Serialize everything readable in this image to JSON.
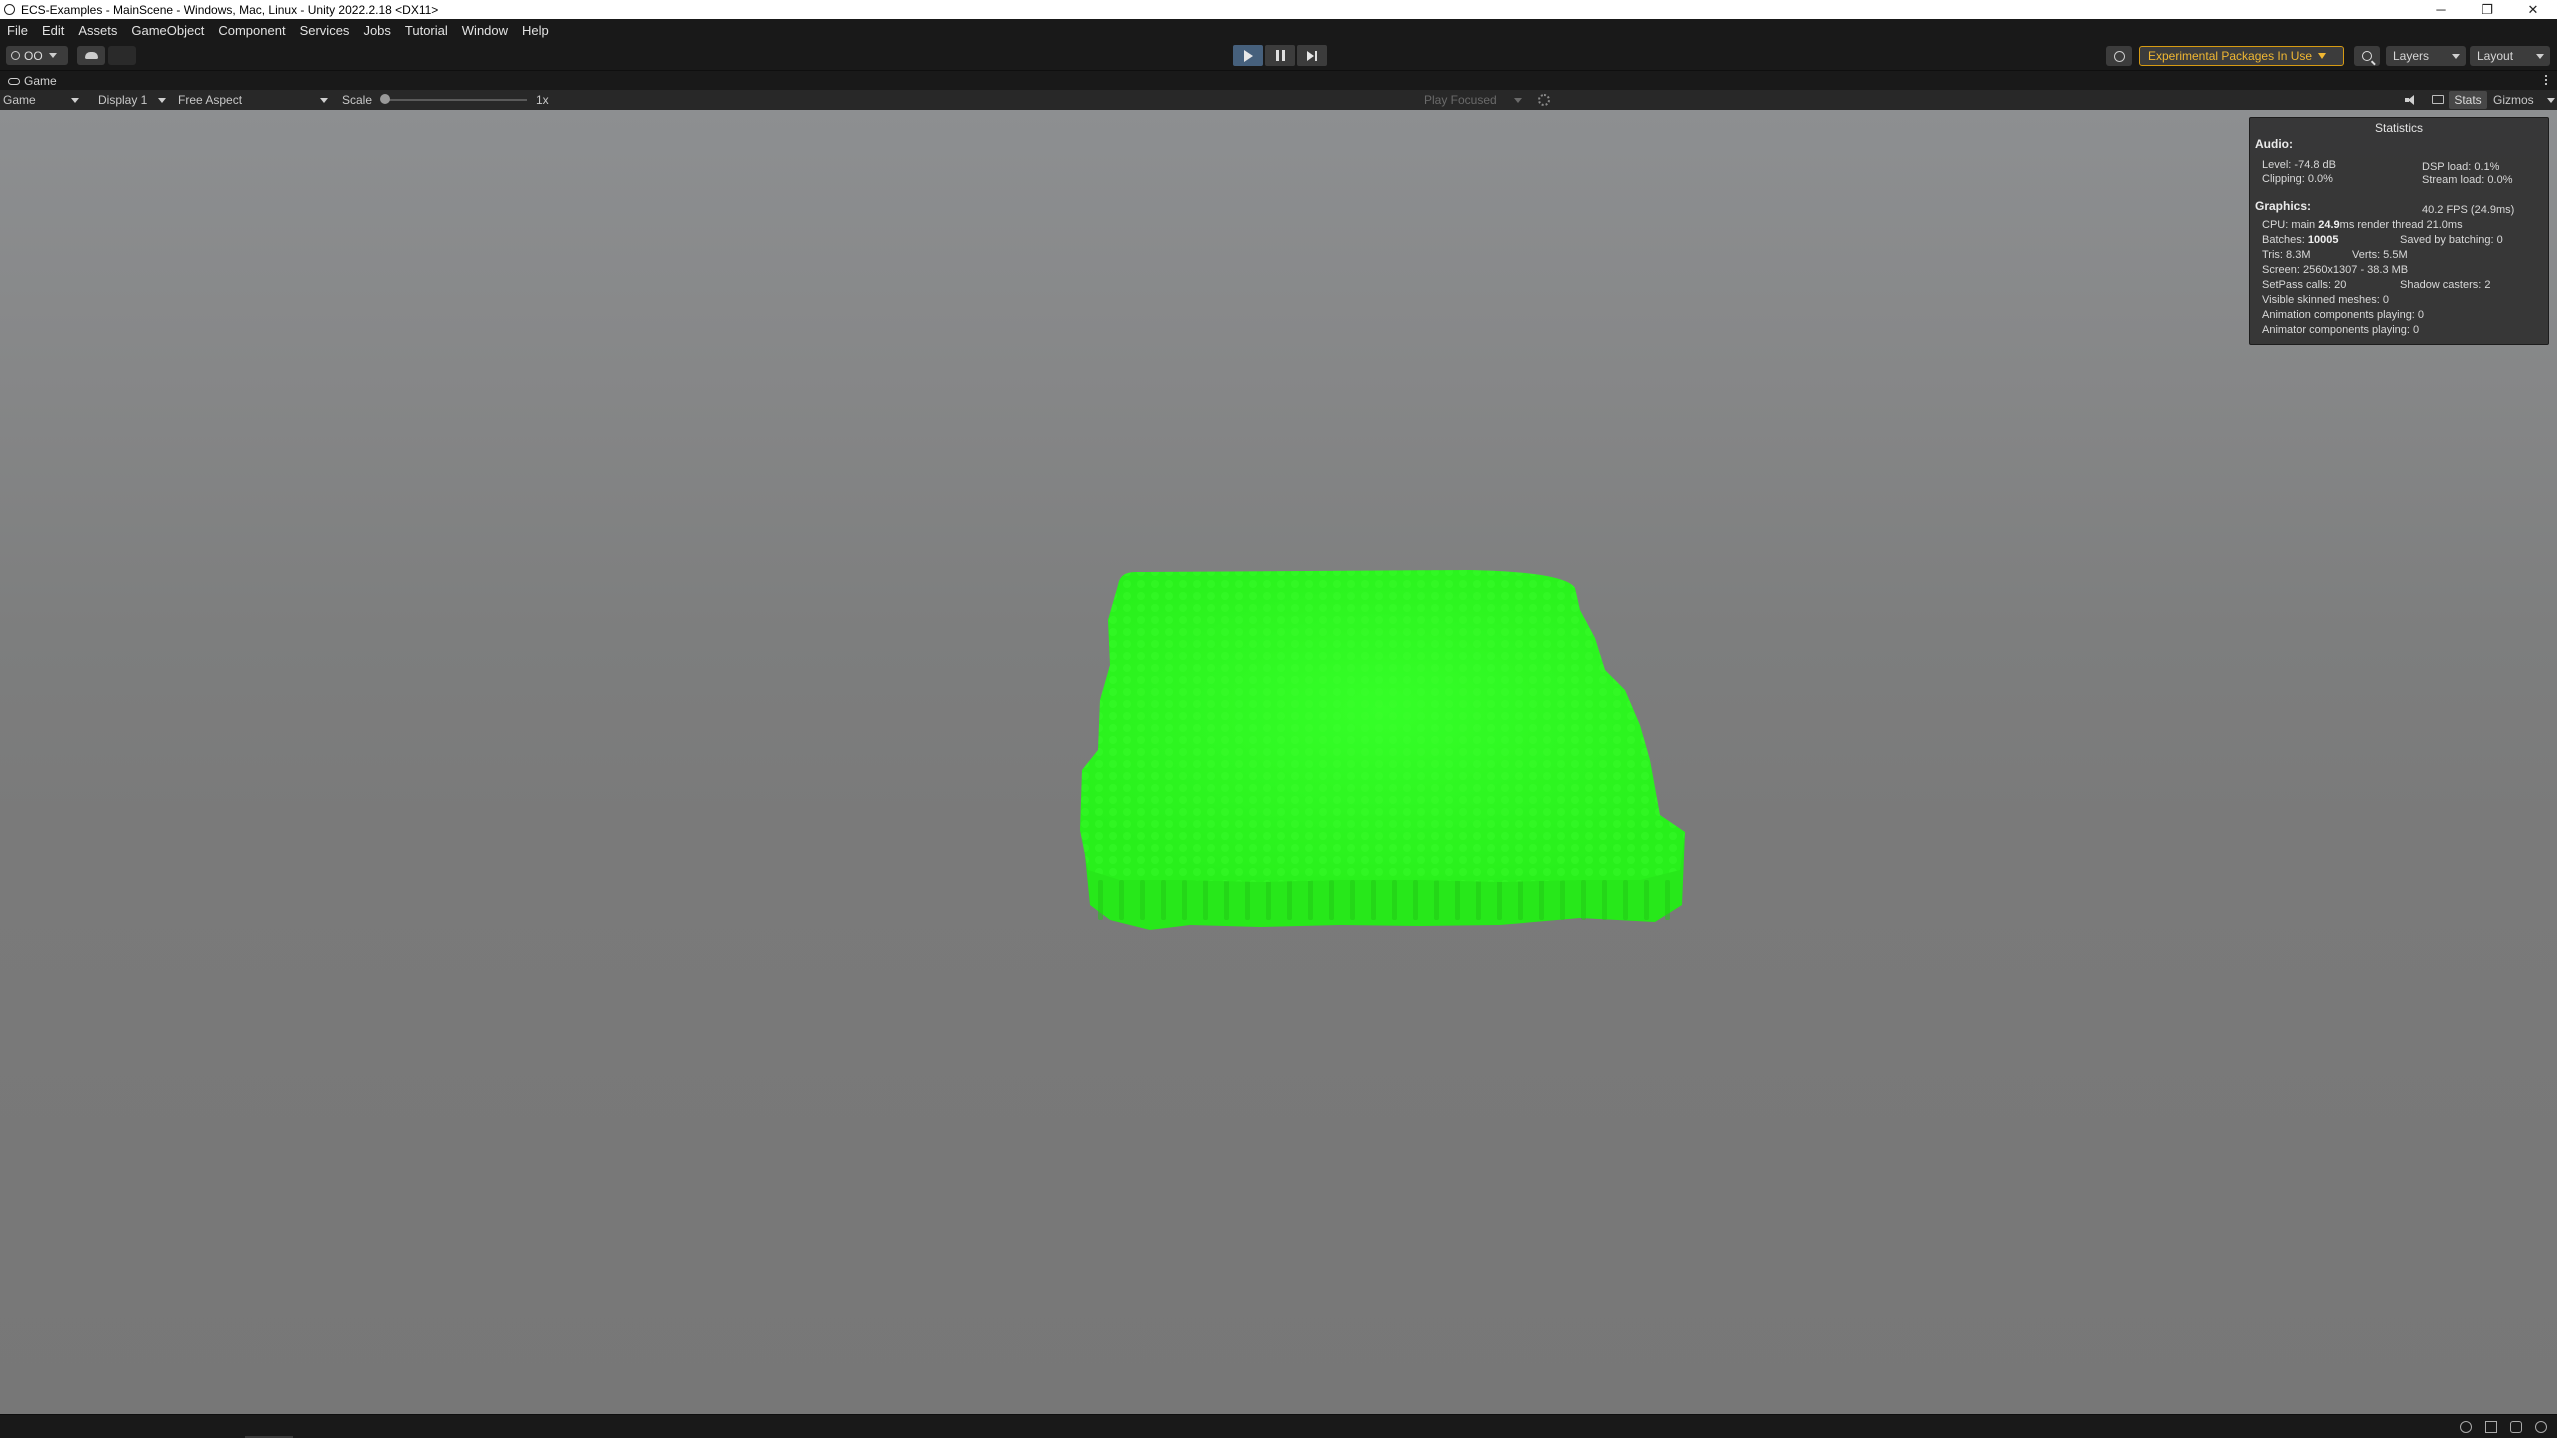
{
  "window": {
    "title": "ECS-Examples - MainScene - Windows, Mac, Linux - Unity 2022.2.18 <DX11>",
    "controls": {
      "minimize": "─",
      "restore": "❐",
      "close": "✕"
    }
  },
  "menu": [
    "File",
    "Edit",
    "Assets",
    "GameObject",
    "Component",
    "Services",
    "Jobs",
    "Tutorial",
    "Window",
    "Help"
  ],
  "toolbar": {
    "account_label": "OO",
    "experimental_label": "Experimental Packages In Use",
    "layers_label": "Layers",
    "layout_label": "Layout",
    "play_mode_active": true
  },
  "tab": {
    "label": "Game"
  },
  "game_toolbar": {
    "view_select": "Game",
    "display_select": "Display 1",
    "aspect_select": "Free Aspect",
    "scale_label": "Scale",
    "scale_value": "1x",
    "play_focused": "Play Focused",
    "stats_label": "Stats",
    "gizmos_label": "Gizmos"
  },
  "statistics": {
    "title": "Statistics",
    "audio_header": "Audio:",
    "level": "Level: -74.8 dB",
    "clipping": "Clipping: 0.0%",
    "dsp_load": "DSP load: 0.1%",
    "stream_load": "Stream load: 0.0%",
    "graphics_header": "Graphics:",
    "fps": "40.2 FPS (24.9ms)",
    "cpu_prefix": "CPU: main",
    "cpu_main": "24.9",
    "cpu_suffix": "ms  render thread 21.0ms",
    "batches_prefix": "Batches:",
    "batches": "10005",
    "saved_by_batching": "Saved by batching: 0",
    "tris": "Tris: 8.3M",
    "verts": "Verts: 5.5M",
    "screen": "Screen: 2560x1307 - 38.3 MB",
    "setpass": "SetPass calls: 20",
    "shadow_casters": "Shadow casters: 2",
    "visible_skinned": "Visible skinned meshes: 0",
    "animation_components": "Animation components playing: 0",
    "animator_components": "Animator components playing: 0"
  },
  "scene": {
    "sky_color": "#8c8e90",
    "ground_color": "#787878",
    "cube_color": "#2cff1e",
    "cube_dark": "#22c817"
  },
  "colors": {
    "editor_bg": "#191919",
    "accent_play": "#46607c",
    "experimental_orange": "#f0b732"
  }
}
